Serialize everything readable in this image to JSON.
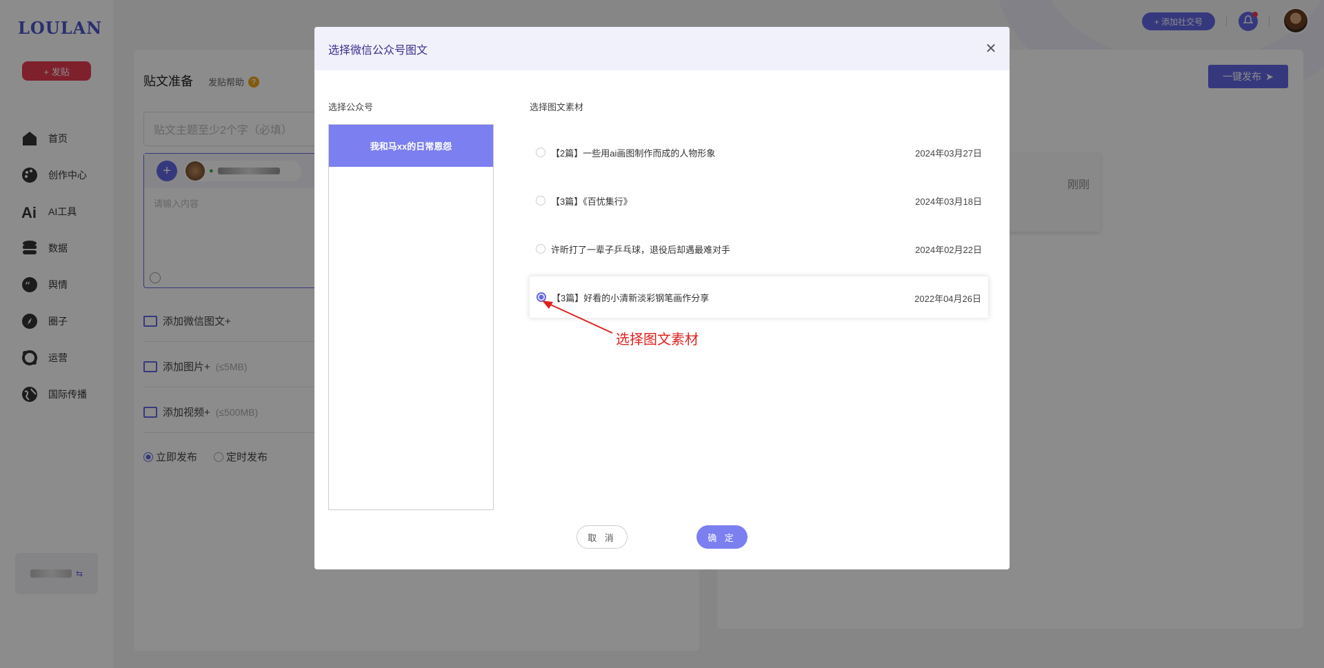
{
  "app": {
    "logo": "LOULAN",
    "post_button": "+ 发贴"
  },
  "nav": [
    {
      "label": "首页",
      "icon": "home-icon"
    },
    {
      "label": "创作中心",
      "icon": "palette-icon"
    },
    {
      "label": "AI工具",
      "icon": "ai-icon"
    },
    {
      "label": "数据",
      "icon": "database-icon"
    },
    {
      "label": "舆情",
      "icon": "quote-icon"
    },
    {
      "label": "圈子",
      "icon": "compass-icon"
    },
    {
      "label": "运营",
      "icon": "operations-icon"
    },
    {
      "label": "国际传播",
      "icon": "globe-icon"
    }
  ],
  "topbar": {
    "add_social": "+ 添加社交号"
  },
  "editor": {
    "title": "贴文准备",
    "help": "发贴帮助",
    "help_icon": "?",
    "topic_placeholder": "贴文主题至少2个字（必填）",
    "content_placeholder": "请输入内容",
    "add_wechat": "添加微信图文+",
    "add_image": "添加图片+",
    "add_image_hint": "(≤5MB)",
    "add_video": "添加视频+",
    "add_video_hint": "(≤500MB)",
    "publish_now": "立即发布",
    "publish_timed": "定时发布"
  },
  "right": {
    "publish_all": "一键发布",
    "preview_time": "刚刚"
  },
  "modal": {
    "title": "选择微信公众号图文",
    "account_label": "选择公众号",
    "material_label": "选择图文素材",
    "accounts": [
      {
        "name": "我和马xx的日常恩怨"
      }
    ],
    "materials": [
      {
        "title": "【2篇】一些用ai画图制作而成的人物形象",
        "date": "2024年03月27日",
        "selected": false
      },
      {
        "title": "【3篇】《百忧集行》",
        "date": "2024年03月18日",
        "selected": false
      },
      {
        "title": "许昕打了一辈子乒乓球，退役后却遇最难对手",
        "date": "2024年02月22日",
        "selected": false
      },
      {
        "title": "【3篇】好看的小清新淡彩钢笔画作分享",
        "date": "2022年04月26日",
        "selected": true
      }
    ],
    "annotation": "选择图文素材",
    "cancel": "取 消",
    "confirm": "确 定"
  },
  "colors": {
    "accent": "#6367e6",
    "post": "#e83b53",
    "annotation": "#e0211f"
  }
}
